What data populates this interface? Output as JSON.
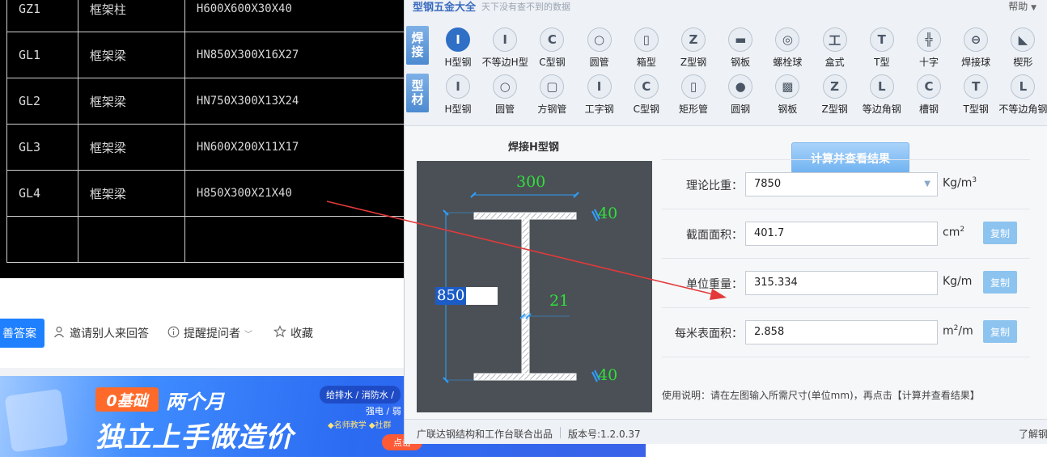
{
  "cad_table": {
    "rows": [
      {
        "code": "GZ1",
        "type": "框架柱",
        "spec": "H600X600X30X40"
      },
      {
        "code": "GL1",
        "type": "框架梁",
        "spec": "HN850X300X16X27"
      },
      {
        "code": "GL2",
        "type": "框架梁",
        "spec": "HN750X300X13X24"
      },
      {
        "code": "GL3",
        "type": "框架梁",
        "spec": "HN600X200X11X17"
      },
      {
        "code": "GL4",
        "type": "框架梁",
        "spec": "H850X300X21X40"
      },
      {
        "code": "",
        "type": "",
        "spec": ""
      }
    ]
  },
  "qa_bar": {
    "answer_label": "善答案",
    "invite_label": "邀请别人来回答",
    "remind_label": "提醒提问者",
    "collect_label": "收藏"
  },
  "banner": {
    "badge": "0基础",
    "title1": "两个月",
    "title2": "独立上手做造价",
    "right_line1": "给排水 / 消防水 /",
    "right_line2": "强电 / 弱",
    "right_line3": "◆名师教学 ◆社群",
    "cta": "点击"
  },
  "app": {
    "title": "型钢五金大全",
    "subtitle": "天下没有查不到的数据",
    "help": "帮助",
    "row1_label": [
      "焊",
      "接"
    ],
    "row2_label": [
      "型",
      "材"
    ],
    "row1_tools": [
      {
        "label": "H型钢",
        "icon": "h-beam-icon",
        "glyph": "I"
      },
      {
        "label": "不等边H型",
        "icon": "unequal-h-icon",
        "glyph": "I"
      },
      {
        "label": "C型钢",
        "icon": "c-channel-icon",
        "glyph": "C"
      },
      {
        "label": "圆管",
        "icon": "round-tube-icon",
        "glyph": "○"
      },
      {
        "label": "箱型",
        "icon": "box-icon",
        "glyph": "▯"
      },
      {
        "label": "Z型钢",
        "icon": "z-section-icon",
        "glyph": "Z"
      },
      {
        "label": "钢板",
        "icon": "steel-plate-icon",
        "glyph": "▬"
      },
      {
        "label": "螺栓球",
        "icon": "bolt-ball-icon",
        "glyph": "◎"
      },
      {
        "label": "盒式",
        "icon": "box-type-icon",
        "glyph": "工"
      },
      {
        "label": "T型",
        "icon": "t-section-icon",
        "glyph": "T"
      },
      {
        "label": "十字",
        "icon": "cross-section-icon",
        "glyph": "╬"
      },
      {
        "label": "焊接球",
        "icon": "weld-ball-icon",
        "glyph": "⊖"
      },
      {
        "label": "楔形",
        "icon": "wedge-icon",
        "glyph": "◣"
      }
    ],
    "row2_tools": [
      {
        "label": "H型钢",
        "icon": "h-beam-icon",
        "glyph": "I"
      },
      {
        "label": "圆管",
        "icon": "round-tube-icon",
        "glyph": "○"
      },
      {
        "label": "方钢管",
        "icon": "square-tube-icon",
        "glyph": "▢"
      },
      {
        "label": "工字钢",
        "icon": "i-beam-icon",
        "glyph": "I"
      },
      {
        "label": "C型钢",
        "icon": "c-channel-icon",
        "glyph": "C"
      },
      {
        "label": "矩形管",
        "icon": "rect-tube-icon",
        "glyph": "▯"
      },
      {
        "label": "圆钢",
        "icon": "round-bar-icon",
        "glyph": "●"
      },
      {
        "label": "钢板",
        "icon": "steel-plate-icon",
        "glyph": "▩"
      },
      {
        "label": "Z型钢",
        "icon": "z-section-icon",
        "glyph": "Z"
      },
      {
        "label": "等边角钢",
        "icon": "equal-angle-icon",
        "glyph": "L"
      },
      {
        "label": "槽钢",
        "icon": "channel-icon",
        "glyph": "C"
      },
      {
        "label": "T型钢",
        "icon": "t-section-icon",
        "glyph": "T"
      },
      {
        "label": "不等边角钢",
        "icon": "unequal-angle-icon",
        "glyph": "L"
      }
    ],
    "diagram": {
      "title": "焊接H型钢",
      "width_value": "300",
      "top_flange": "40",
      "web": "21",
      "bottom_flange": "40",
      "height_value": "850"
    },
    "calc_button": "计算并查看结果",
    "fields": [
      {
        "label": "理论比重：",
        "value": "7850",
        "unit": "Kg/m",
        "unit_sup": "3",
        "dropdown": true,
        "copy": ""
      },
      {
        "label": "截面面积：",
        "value": "401.7",
        "unit": "cm",
        "unit_sup": "2",
        "dropdown": false,
        "copy": "复制"
      },
      {
        "label": "单位重量：",
        "value": "315.334",
        "unit": "Kg/m",
        "unit_sup": "",
        "dropdown": false,
        "copy": "复制"
      },
      {
        "label": "每米表面积：",
        "value": "2.858",
        "unit": "m",
        "unit_sup": "2",
        "unit_tail": "/m",
        "dropdown": false,
        "copy": "复制"
      }
    ],
    "usage": "使用说明：请在左图输入所需尺寸(单位mm)，再点击【计算并查看结果】",
    "status": {
      "producer": "广联达钢结构和工作台联合出品",
      "version": "版本号:1.2.0.37",
      "right": "了解钢"
    },
    "colors": {
      "accent": "#2f6fc6",
      "dim_green": "#2ee13a",
      "arrow": "#e23a3a"
    }
  }
}
